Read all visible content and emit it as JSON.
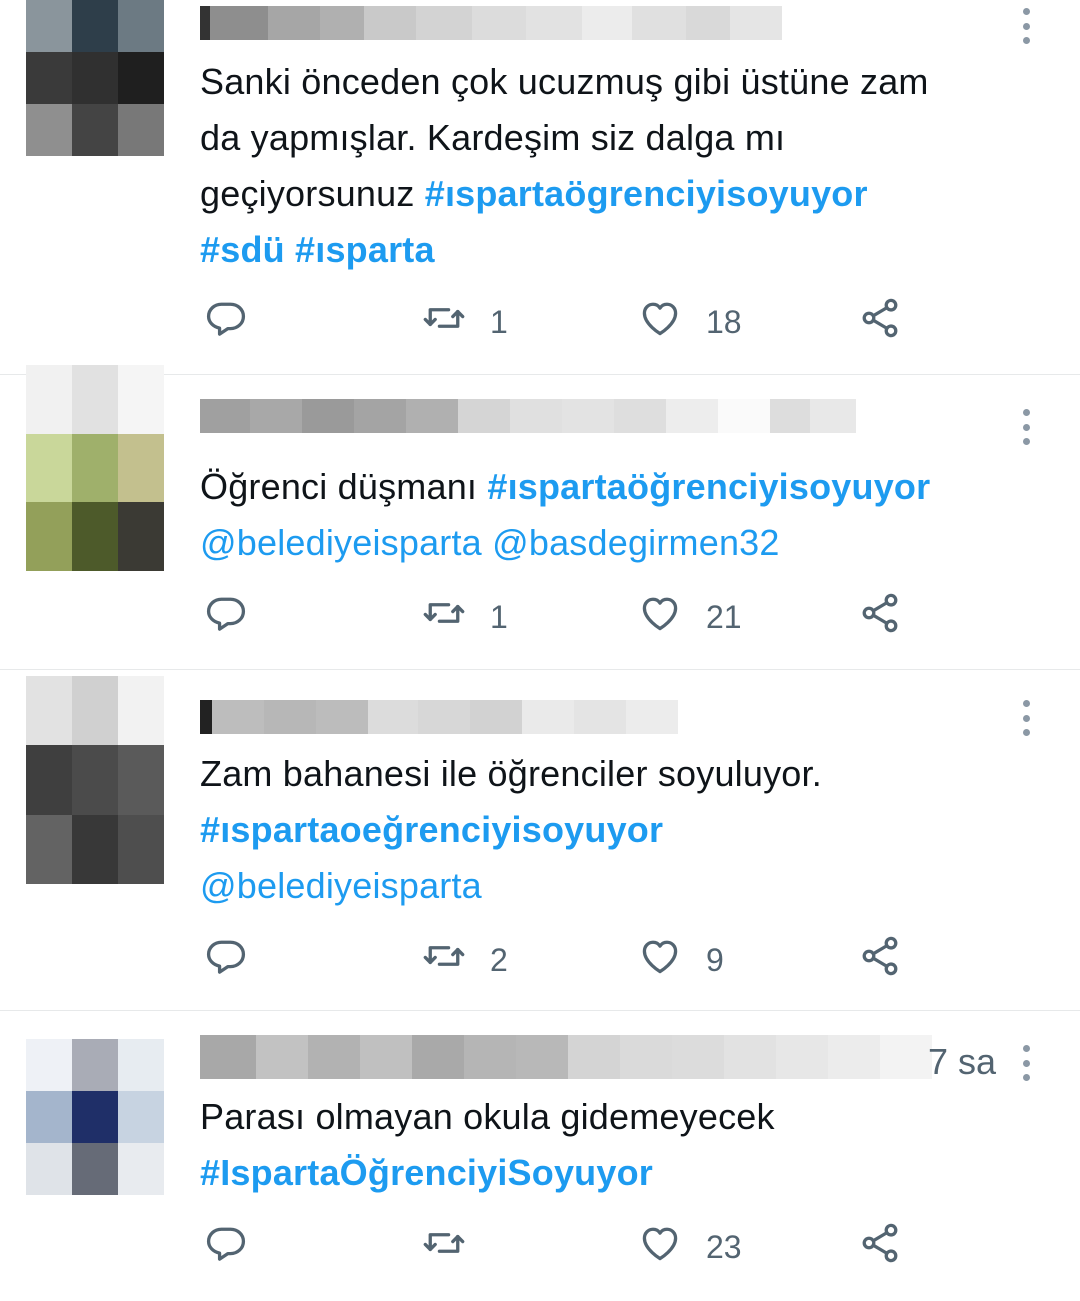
{
  "tweets": [
    {
      "text_lines": [
        [
          {
            "t": "Sanki önceden çok ucuzmuş gibi üstüne zam",
            "k": "text"
          }
        ],
        [
          {
            "t": "da yapmışlar. Kardeşim siz dalga mı",
            "k": "text"
          }
        ],
        [
          {
            "t": "geçiyorsunuz ",
            "k": "text"
          },
          {
            "t": "#ıspartaögrenciyisoyuyor",
            "k": "hashtag"
          }
        ],
        [
          {
            "t": "#sdü",
            "k": "hashtag"
          },
          {
            "t": " ",
            "k": "text"
          },
          {
            "t": "#ısparta",
            "k": "hashtag"
          }
        ]
      ],
      "time": "",
      "replies": "",
      "retweets": "1",
      "likes": "18"
    },
    {
      "text_lines": [
        [
          {
            "t": "Öğrenci düşmanı ",
            "k": "text"
          },
          {
            "t": "#ıspartaöğrenciyisoyuyor",
            "k": "hashtag"
          }
        ],
        [
          {
            "t": "@belediyeisparta",
            "k": "mention"
          },
          {
            "t": " ",
            "k": "text"
          },
          {
            "t": "@basdegirmen32",
            "k": "mention"
          }
        ]
      ],
      "time": "",
      "replies": "",
      "retweets": "1",
      "likes": "21"
    },
    {
      "text_lines": [
        [
          {
            "t": "Zam bahanesi ile öğrenciler soyuluyor.",
            "k": "text"
          }
        ],
        [
          {
            "t": "#ıspartaoeğrenciyisoyuyor",
            "k": "hashtag"
          }
        ],
        [
          {
            "t": "@belediyeisparta",
            "k": "mention"
          }
        ]
      ],
      "time": "",
      "replies": "",
      "retweets": "2",
      "likes": "9"
    },
    {
      "text_lines": [
        [
          {
            "t": "Parası olmayan okula gidemeyecek",
            "k": "text"
          }
        ],
        [
          {
            "t": "#IspartaÖğrenciyiSoyuyor",
            "k": "hashtag"
          }
        ]
      ],
      "time": "7 sa",
      "replies": "",
      "retweets": "",
      "likes": "23"
    }
  ],
  "icons": {
    "reply": "reply-icon",
    "retweet": "retweet-icon",
    "like": "like-icon",
    "share": "share-icon",
    "more": "more-icon"
  },
  "colors": {
    "link": "#1d9bf0",
    "text": "#0f1419",
    "secondary": "#536471",
    "divider": "#e7e9ea"
  }
}
